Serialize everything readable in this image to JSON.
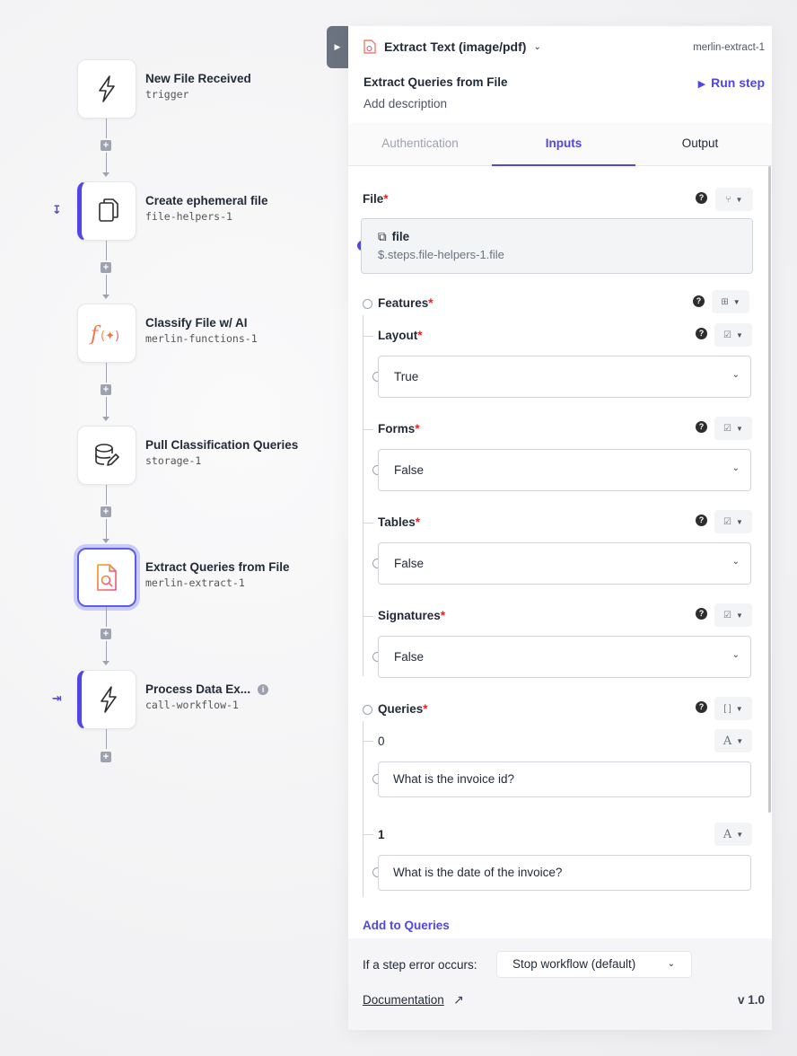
{
  "workflow": {
    "nodes": [
      {
        "title": "New File Received",
        "sub": "trigger"
      },
      {
        "title": "Create ephemeral file",
        "sub": "file-helpers-1"
      },
      {
        "title": "Classify File w/ AI",
        "sub": "merlin-functions-1"
      },
      {
        "title": "Pull Classification Queries",
        "sub": "storage-1"
      },
      {
        "title": "Extract Queries from File",
        "sub": "merlin-extract-1"
      },
      {
        "title": "Process Data Ex...",
        "sub": "call-workflow-1"
      }
    ],
    "selected_index": 4
  },
  "panel": {
    "step_type": "Extract Text (image/pdf)",
    "step_id": "merlin-extract-1",
    "step_name": "Extract Queries from File",
    "run_step": "Run step",
    "add_description": "Add description",
    "tabs": [
      "Authentication",
      "Inputs",
      "Output"
    ],
    "active_tab": "Inputs",
    "file": {
      "label": "File",
      "name": "file",
      "path": "$.steps.file-helpers-1.file"
    },
    "features": {
      "label": "Features",
      "items": [
        {
          "label": "Layout",
          "value": "True"
        },
        {
          "label": "Forms",
          "value": "False"
        },
        {
          "label": "Tables",
          "value": "False"
        },
        {
          "label": "Signatures",
          "value": "False"
        }
      ]
    },
    "queries": {
      "label": "Queries",
      "items": [
        {
          "index": "0",
          "value": "What is the invoice id?"
        },
        {
          "index": "1",
          "value": "What is the date of the invoice?"
        }
      ],
      "add_label": "Add to Queries"
    },
    "footer": {
      "error_label": "If a step error occurs:",
      "error_value": "Stop workflow (default)",
      "documentation": "Documentation",
      "version": "v 1.0"
    }
  },
  "colors": {
    "accent": "#4f46e5",
    "required": "#dc2626"
  }
}
